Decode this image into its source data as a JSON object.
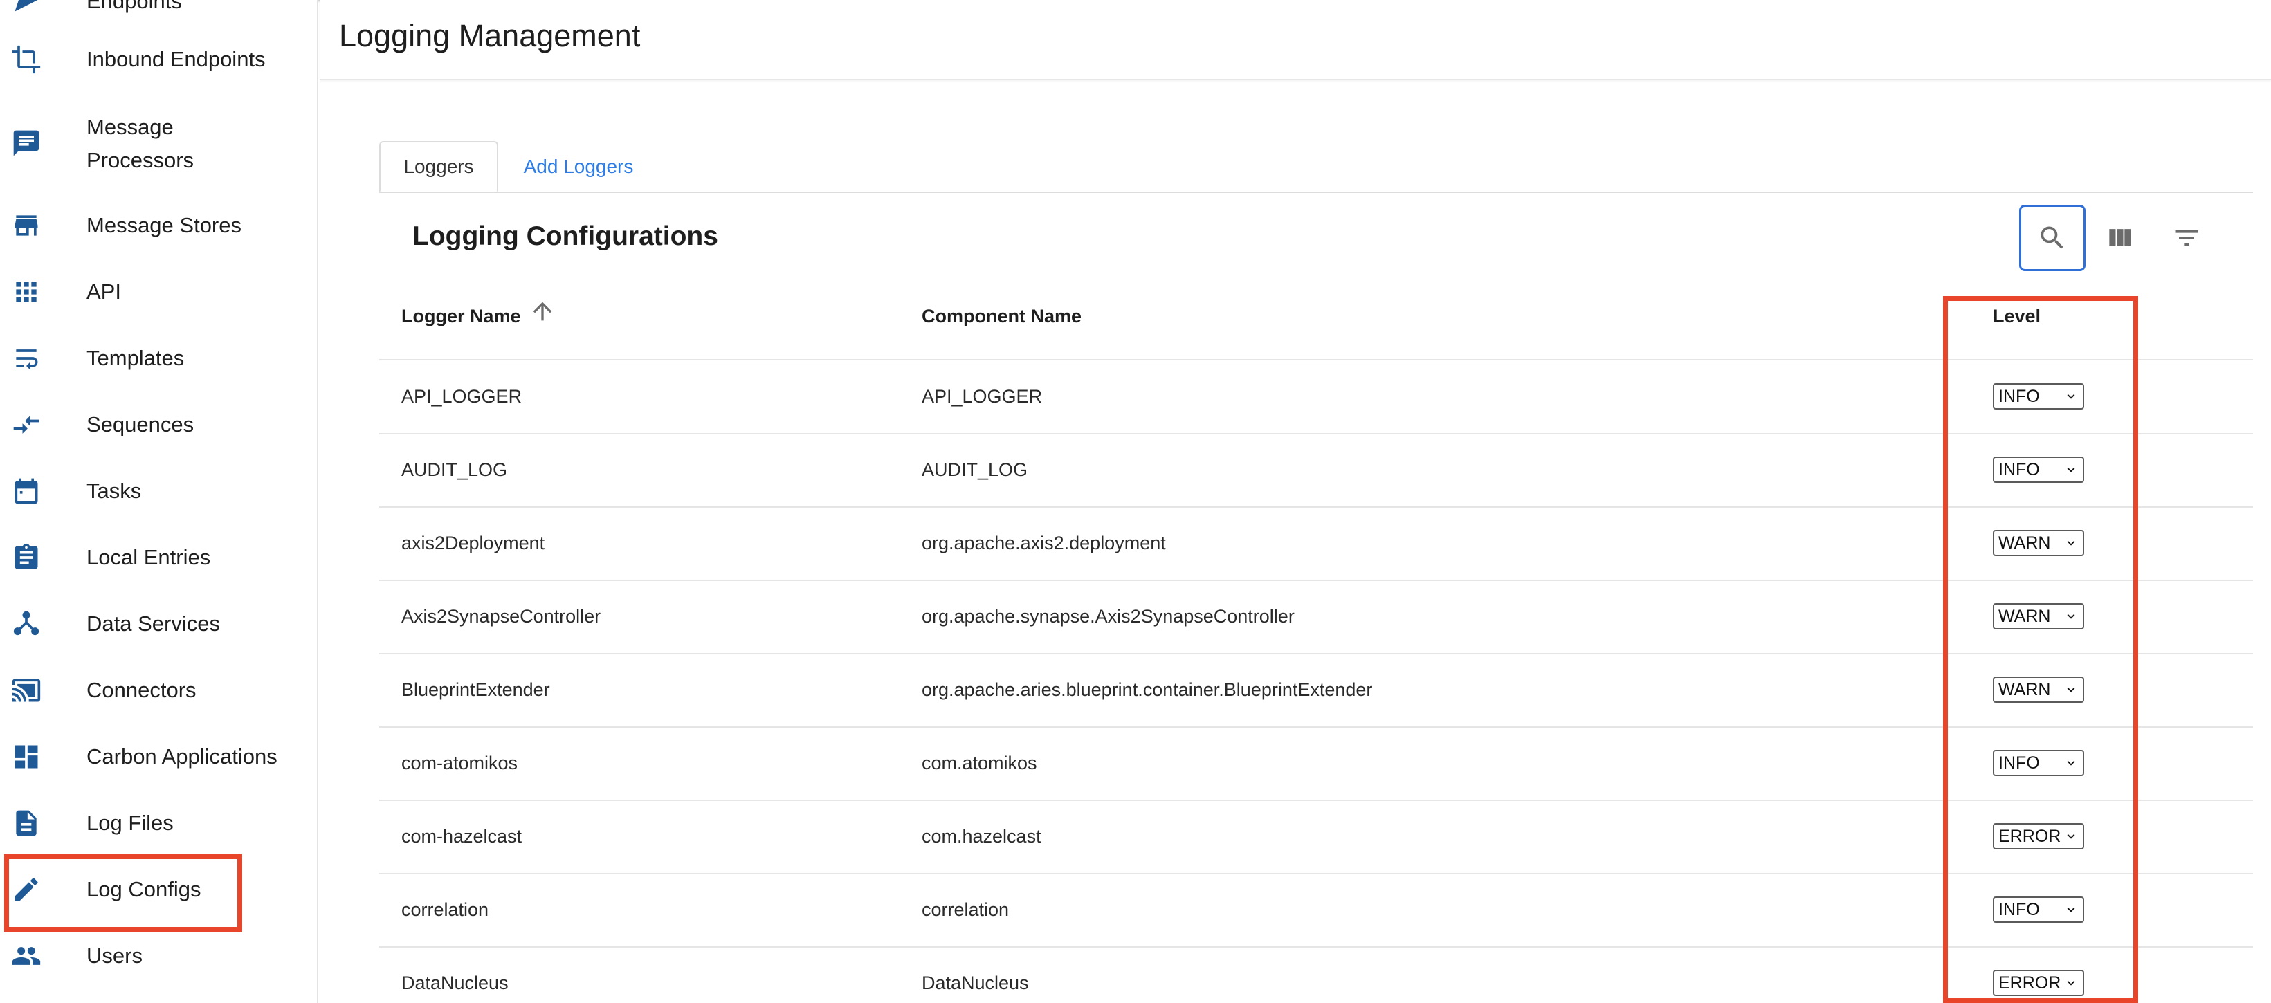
{
  "sidebar": {
    "items": [
      {
        "label": "Endpoints",
        "icon": "send-icon"
      },
      {
        "label": "Inbound Endpoints",
        "icon": "crop-icon"
      },
      {
        "label": "Message\nProcessors",
        "icon": "message-icon"
      },
      {
        "label": "Message Stores",
        "icon": "store-icon"
      },
      {
        "label": "API",
        "icon": "apps-grid-icon"
      },
      {
        "label": "Templates",
        "icon": "wrap-text-icon"
      },
      {
        "label": "Sequences",
        "icon": "compare-arrows-icon"
      },
      {
        "label": "Tasks",
        "icon": "calendar-icon"
      },
      {
        "label": "Local Entries",
        "icon": "clipboard-icon"
      },
      {
        "label": "Data Services",
        "icon": "hub-icon"
      },
      {
        "label": "Connectors",
        "icon": "cast-icon"
      },
      {
        "label": "Carbon Applications",
        "icon": "dashboard-icon"
      },
      {
        "label": "Log Files",
        "icon": "document-icon"
      },
      {
        "label": "Log Configs",
        "icon": "pencil-icon"
      },
      {
        "label": "Users",
        "icon": "people-icon"
      }
    ]
  },
  "header": {
    "title": "Logging Management"
  },
  "tabs": [
    {
      "label": "Loggers"
    },
    {
      "label": "Add Loggers"
    }
  ],
  "section": {
    "title": "Logging Configurations"
  },
  "toolbar": {
    "icons": [
      "search-icon",
      "view-columns-icon",
      "filter-icon"
    ]
  },
  "table": {
    "columns": [
      "Logger Name",
      "Component Name",
      "Level"
    ],
    "sort": {
      "column": "Logger Name",
      "direction": "ascending"
    },
    "rows": [
      {
        "logger": "API_LOGGER",
        "component": "API_LOGGER",
        "level": "INFO"
      },
      {
        "logger": "AUDIT_LOG",
        "component": "AUDIT_LOG",
        "level": "INFO"
      },
      {
        "logger": "axis2Deployment",
        "component": "org.apache.axis2.deployment",
        "level": "WARN"
      },
      {
        "logger": "Axis2SynapseController",
        "component": "org.apache.synapse.Axis2SynapseController",
        "level": "WARN"
      },
      {
        "logger": "BlueprintExtender",
        "component": "org.apache.aries.blueprint.container.BlueprintExtender",
        "level": "WARN"
      },
      {
        "logger": "com-atomikos",
        "component": "com.atomikos",
        "level": "INFO"
      },
      {
        "logger": "com-hazelcast",
        "component": "com.hazelcast",
        "level": "ERROR"
      },
      {
        "logger": "correlation",
        "component": "correlation",
        "level": "INFO"
      },
      {
        "logger": "DataNucleus",
        "component": "DataNucleus",
        "level": "ERROR"
      }
    ]
  },
  "colors": {
    "accent": "#2d7be5",
    "icon": "#1f5a96",
    "highlight": "#e8452b"
  }
}
